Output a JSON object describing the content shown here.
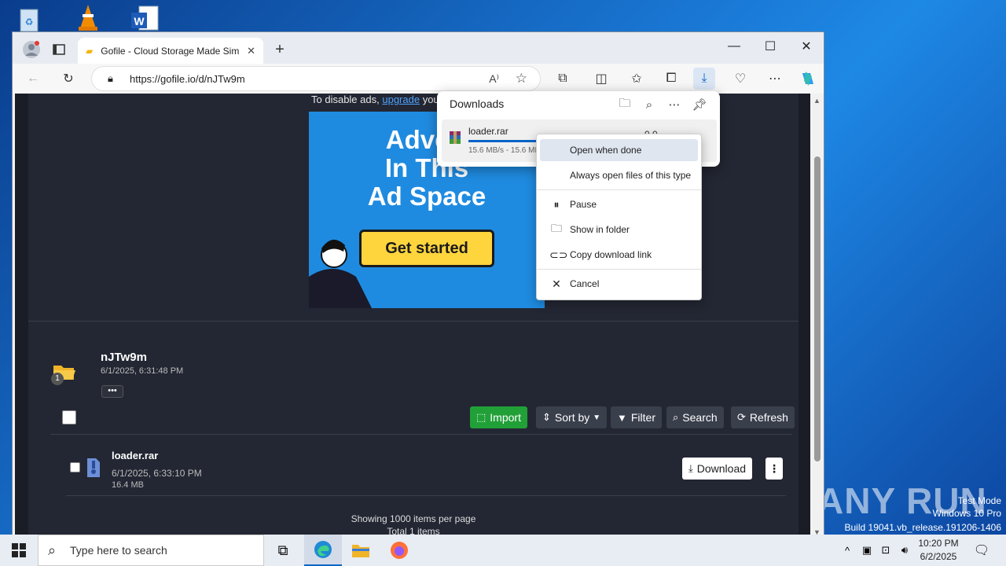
{
  "browser": {
    "tab_title": "Gofile - Cloud Storage Made Sim",
    "url": "https://gofile.io/d/nJTw9m"
  },
  "ad": {
    "notice_prefix": "To disable ads,",
    "notice_link": "upgrade",
    "notice_suffix": "your",
    "headline_1": "Advert",
    "headline_2": "In This",
    "headline_3": "Ad Space",
    "cta": "Get started"
  },
  "folder": {
    "name": "nJTw9m",
    "date": "6/1/2025, 6:31:48 PM",
    "badge": "1",
    "more": "•••"
  },
  "actions": {
    "import": "Import",
    "sort": "Sort by",
    "filter": "Filter",
    "search": "Search",
    "refresh": "Refresh"
  },
  "file": {
    "name": "loader.rar",
    "date": "6/1/2025, 6:33:10 PM",
    "size": "16.4 MB",
    "download": "Download"
  },
  "footer": {
    "per_page": "Showing 1000 items per page",
    "total": "Total 1 items"
  },
  "downloads_panel": {
    "title": "Downloads",
    "item_name": "loader.rar",
    "item_progress": "15.6 MB/s - 15.6 MB",
    "item_status": "0.0"
  },
  "context_menu": {
    "open_when_done": "Open when done",
    "always_open": "Always open files of this type",
    "pause": "Pause",
    "show_in_folder": "Show in folder",
    "copy_link": "Copy download link",
    "cancel": "Cancel"
  },
  "taskbar": {
    "search_placeholder": "Type here to search",
    "time": "10:20 PM",
    "date": "6/2/2025"
  },
  "watermark": {
    "line1": "Test Mode",
    "line2": "Windows 10 Pro",
    "line3": "Build 19041.vb_release.191206-1406",
    "brand": "ANY RUN"
  },
  "colors": {
    "import_green": "#21a038",
    "accent_blue": "#0a64c8",
    "page_bg": "#232733"
  }
}
